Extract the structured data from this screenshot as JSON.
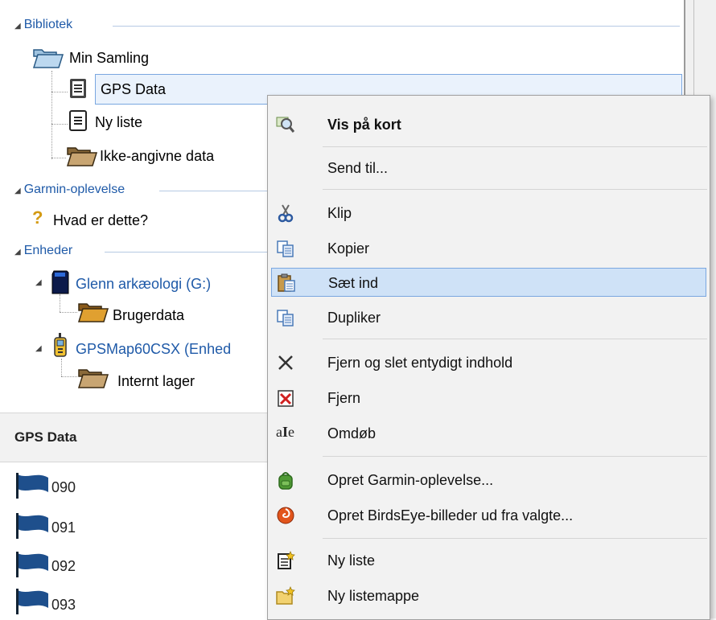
{
  "tree": {
    "sections": {
      "library": "Bibliotek",
      "garmin": "Garmin-oplevelse",
      "devices": "Enheder"
    },
    "library_items": {
      "collection": "Min Samling",
      "gps_data": "GPS Data",
      "new_list": "Ny liste",
      "unspecified": "Ikke-angivne data"
    },
    "garmin_items": {
      "what_is_this": "Hvad er dette?"
    },
    "device_items": {
      "device1": "Glenn arkæologi (G:)",
      "device1_folder": "Brugerdata",
      "device2": "GPSMap60CSX (Enhed",
      "device2_folder": "Internt lager"
    }
  },
  "list_panel": {
    "title": "GPS Data",
    "waypoints": [
      "090",
      "091",
      "092",
      "093"
    ]
  },
  "context_menu": {
    "items": [
      {
        "label": "Vis på kort",
        "icon": "magnifier-map-icon"
      },
      {
        "label": "Send til...",
        "icon": ""
      },
      {
        "label": "Klip",
        "icon": "scissors-icon"
      },
      {
        "label": "Kopier",
        "icon": "copy-icon"
      },
      {
        "label": "Sæt ind",
        "icon": "paste-icon"
      },
      {
        "label": "Dupliker",
        "icon": "duplicate-icon"
      },
      {
        "label": "Fjern og slet entydigt indhold",
        "icon": "x-icon"
      },
      {
        "label": "Fjern",
        "icon": "remove-icon"
      },
      {
        "label": "Omdøb",
        "icon": "rename-icon"
      },
      {
        "label": "Opret Garmin-oplevelse...",
        "icon": "backpack-icon"
      },
      {
        "label": "Opret BirdsEye-billeder ud fra valgte...",
        "icon": "birdseye-icon"
      },
      {
        "label": "Ny liste",
        "icon": "new-list-icon"
      },
      {
        "label": "Ny listemappe",
        "icon": "new-folder-icon"
      }
    ]
  },
  "colors": {
    "section_blue": "#1f5aa8",
    "highlight": "#cfe2f7",
    "flag_blue": "#1e4f8c"
  }
}
